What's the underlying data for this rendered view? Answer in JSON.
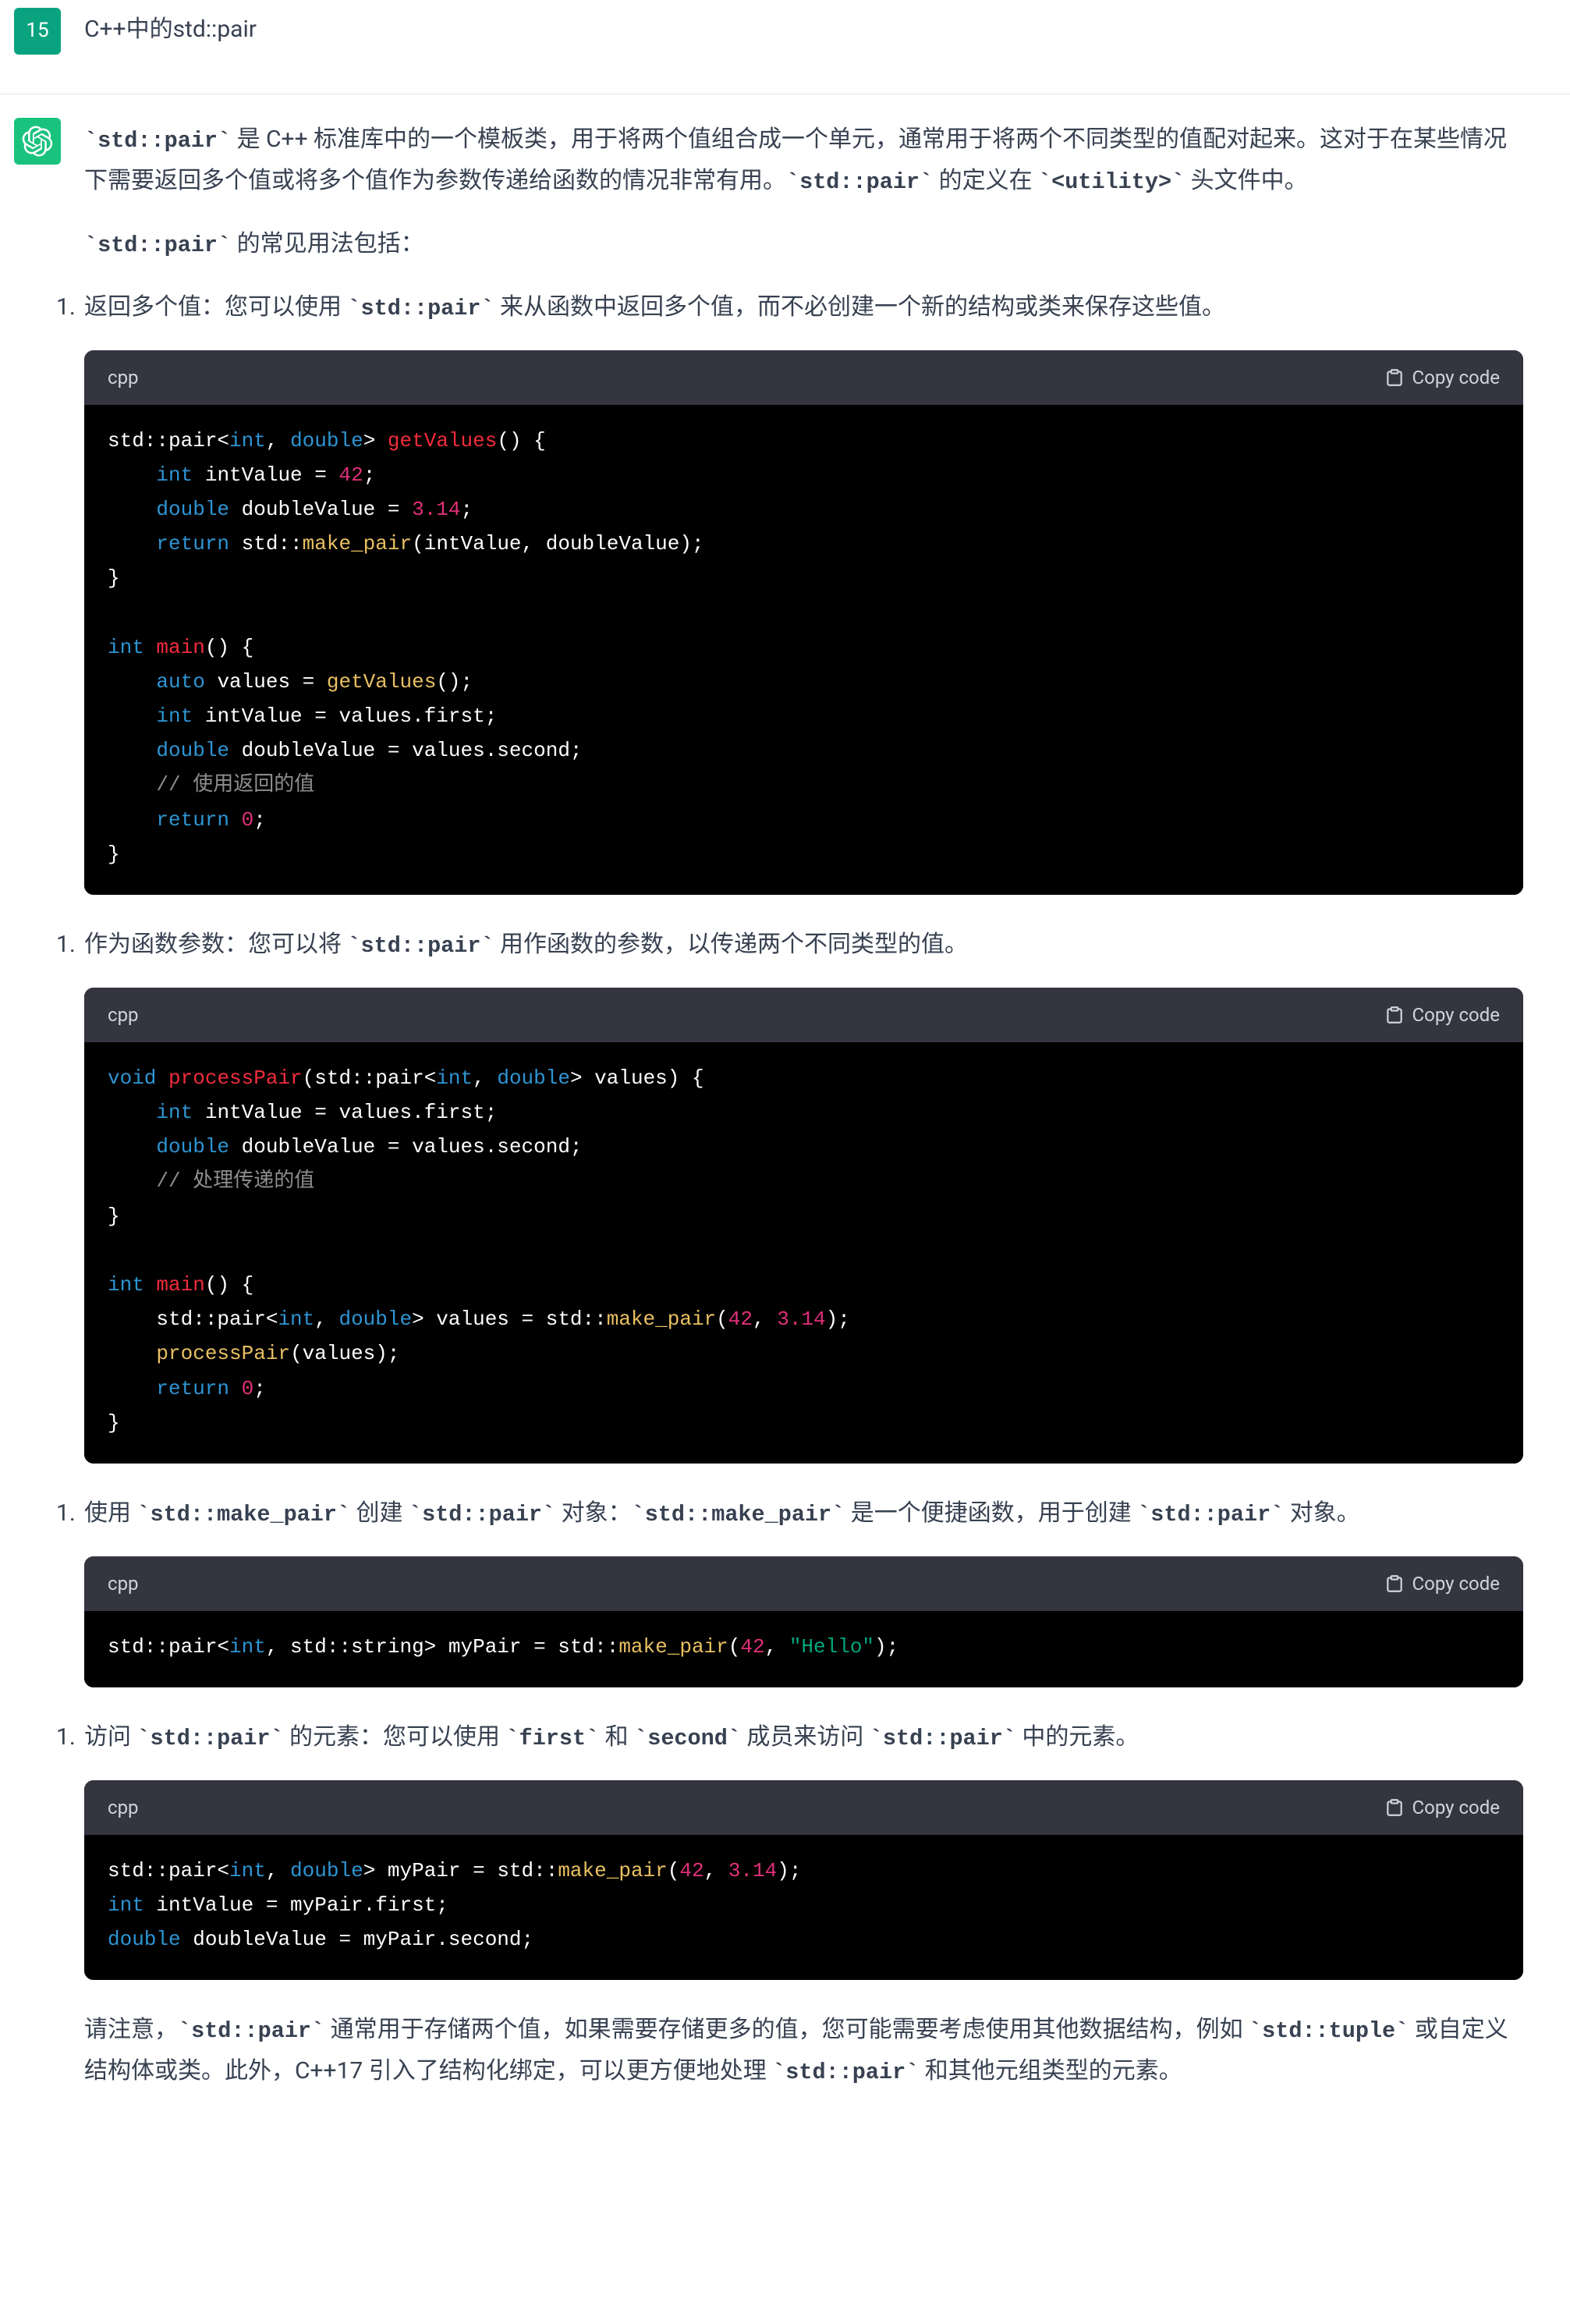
{
  "user": {
    "avatar": "15",
    "message": "C++中的std::pair"
  },
  "assistant": {
    "intro_p1_a": "`std::pair`",
    "intro_p1_b": " 是 C++ 标准库中的一个模板类，用于将两个值组合成一个单元，通常用于将两个不同类型的值配对起来。这对于在某些情况下需要返回多个值或将多个值作为参数传递给函数的情况非常有用。",
    "intro_p1_c": "`std::pair`",
    "intro_p1_d": " 的定义在 ",
    "intro_p1_e": "`<utility>`",
    "intro_p1_f": " 头文件中。",
    "intro_p2_a": "`std::pair`",
    "intro_p2_b": " 的常见用法包括：",
    "li1_num": "1.",
    "li1_a": "返回多个值：您可以使用 ",
    "li1_b": "`std::pair`",
    "li1_c": " 来从函数中返回多个值，而不必创建一个新的结构或类来保存这些值。",
    "li2_num": "1.",
    "li2_a": "作为函数参数：您可以将 ",
    "li2_b": "`std::pair`",
    "li2_c": " 用作函数的参数，以传递两个不同类型的值。",
    "li3_num": "1.",
    "li3_a": "使用 ",
    "li3_b": "`std::make_pair`",
    "li3_c": " 创建 ",
    "li3_d": "`std::pair`",
    "li3_e": " 对象：",
    "li3_f": "`std::make_pair`",
    "li3_g": " 是一个便捷函数，用于创建 ",
    "li3_h": "`std::pair`",
    "li3_i": " 对象。",
    "li4_num": "1.",
    "li4_a": "访问 ",
    "li4_b": "`std::pair`",
    "li4_c": " 的元素：您可以使用 ",
    "li4_d": "`first`",
    "li4_e": " 和 ",
    "li4_f": "`second`",
    "li4_g": " 成员来访问 ",
    "li4_h": "`std::pair`",
    "li4_i": " 中的元素。",
    "outro_a": "请注意，",
    "outro_b": "`std::pair`",
    "outro_c": " 通常用于存储两个值，如果需要存储更多的值，您可能需要考虑使用其他数据结构，例如 ",
    "outro_d": "`std::tuple`",
    "outro_e": " 或自定义结构体或类。此外，C++17 引入了结构化绑定，可以更方便地处理 ",
    "outro_f": "`std::pair`",
    "outro_g": " 和其他元组类型的元素。",
    "lang": "cpp",
    "copy": "Copy code",
    "code1": {
      "l1": {
        "a": "std::pair<",
        "b": "int",
        "c": ", ",
        "d": "double",
        "e": "> ",
        "f": "getValues",
        "g": "() {"
      },
      "l2": {
        "a": "    ",
        "b": "int",
        "c": " intValue = ",
        "d": "42",
        "e": ";"
      },
      "l3": {
        "a": "    ",
        "b": "double",
        "c": " doubleValue = ",
        "d": "3.14",
        "e": ";"
      },
      "l4": {
        "a": "    ",
        "b": "return",
        "c": " std::",
        "d": "make_pair",
        "e": "(intValue, doubleValue);"
      },
      "l5": {
        "a": "}"
      },
      "l6": {
        "a": ""
      },
      "l7": {
        "a": "int",
        "b": " ",
        "c": "main",
        "d": "() {"
      },
      "l8": {
        "a": "    ",
        "b": "auto",
        "c": " values = ",
        "d": "getValues",
        "e": "();"
      },
      "l9": {
        "a": "    ",
        "b": "int",
        "c": " intValue = values.first;"
      },
      "l10": {
        "a": "    ",
        "b": "double",
        "c": " doubleValue = values.second;"
      },
      "l11": {
        "a": "    ",
        "b": "// 使用返回的值"
      },
      "l12": {
        "a": "    ",
        "b": "return",
        "c": " ",
        "d": "0",
        "e": ";"
      },
      "l13": {
        "a": "}"
      }
    },
    "code2": {
      "l1": {
        "a": "void",
        "b": " ",
        "c": "processPair",
        "d": "(std::pair<",
        "e": "int",
        "f": ", ",
        "g": "double",
        "h": "> values) {"
      },
      "l2": {
        "a": "    ",
        "b": "int",
        "c": " intValue = values.first;"
      },
      "l3": {
        "a": "    ",
        "b": "double",
        "c": " doubleValue = values.second;"
      },
      "l4": {
        "a": "    ",
        "b": "// 处理传递的值"
      },
      "l5": {
        "a": "}"
      },
      "l6": {
        "a": ""
      },
      "l7": {
        "a": "int",
        "b": " ",
        "c": "main",
        "d": "() {"
      },
      "l8": {
        "a": "    std::pair<",
        "b": "int",
        "c": ", ",
        "d": "double",
        "e": "> values = std::",
        "f": "make_pair",
        "g": "(",
        "h": "42",
        "i": ", ",
        "j": "3.14",
        "k": ");"
      },
      "l9": {
        "a": "    ",
        "b": "processPair",
        "c": "(values);"
      },
      "l10": {
        "a": "    ",
        "b": "return",
        "c": " ",
        "d": "0",
        "e": ";"
      },
      "l11": {
        "a": "}"
      }
    },
    "code3": {
      "l1": {
        "a": "std::pair<",
        "b": "int",
        "c": ", std::string> myPair = std::",
        "d": "make_pair",
        "e": "(",
        "f": "42",
        "g": ", ",
        "h": "\"Hello\"",
        "i": ");"
      }
    },
    "code4": {
      "l1": {
        "a": "std::pair<",
        "b": "int",
        "c": ", ",
        "d": "double",
        "e": "> myPair = std::",
        "f": "make_pair",
        "g": "(",
        "h": "42",
        "i": ", ",
        "j": "3.14",
        "k": ");"
      },
      "l2": {
        "a": "int",
        "b": " intValue = myPair.first;"
      },
      "l3": {
        "a": "double",
        "b": " doubleValue = myPair.second;"
      }
    }
  }
}
